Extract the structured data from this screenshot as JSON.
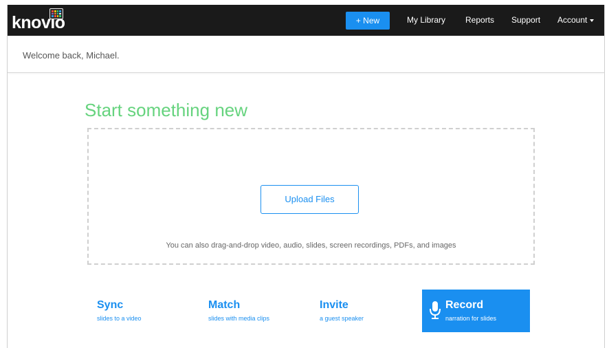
{
  "header": {
    "logo_text": "knovio",
    "new_button": "+ New",
    "nav": [
      "My Library",
      "Reports",
      "Support"
    ],
    "account": "Account",
    "brand_colors": {
      "accent": "#1a8ff0",
      "green": "#66d37e",
      "topbar": "#1a1a1a"
    }
  },
  "welcome": {
    "text": "Welcome back, Michael."
  },
  "start": {
    "title": "Start something new",
    "upload_label": "Upload Files",
    "drop_hint": "You can also drag-and-drop video, audio, slides, screen recordings, PDFs, and images"
  },
  "actions": [
    {
      "title": "Sync",
      "subtitle": "slides to a video"
    },
    {
      "title": "Match",
      "subtitle": "slides with media clips"
    },
    {
      "title": "Invite",
      "subtitle": "a guest speaker"
    },
    {
      "title": "Record",
      "subtitle": "narration for slides",
      "icon": "microphone-icon"
    }
  ]
}
